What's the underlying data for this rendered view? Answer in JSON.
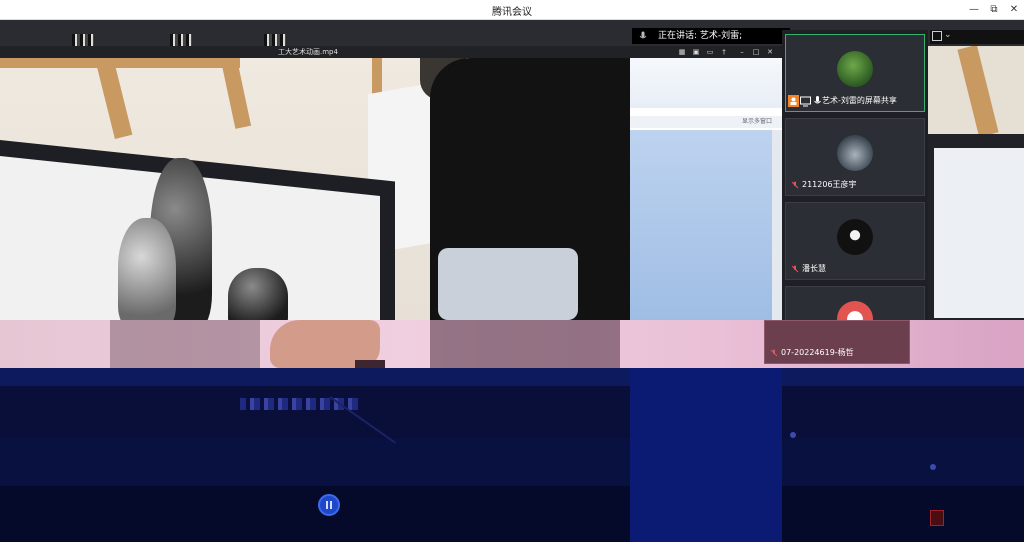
{
  "window": {
    "title": "腾讯会议",
    "minimize_icon": "minimize-icon",
    "maximize_icon": "restore-icon",
    "close_icon": "close-icon"
  },
  "speaking_indicator": {
    "label": "正在讲话: 艺术-刘雷;"
  },
  "player": {
    "file_name": "工大艺术动画.mp4"
  },
  "shared_doc": {
    "toolbar_hint": "显示多窗口"
  },
  "participants": [
    {
      "name": "艺术-刘雷的屏幕共享",
      "state": "sharing"
    },
    {
      "name": "211206王彦宇",
      "state": "muted"
    },
    {
      "name": "潘长慧",
      "state": "muted"
    },
    {
      "name": "07-20224619-杨哲",
      "state": "muted"
    }
  ],
  "colors": {
    "active_border": "#36b36a",
    "share_orange": "#f0852a",
    "card_bg": "#2b2e34",
    "glitch_navy": "#0a0f3a",
    "glitch_pink": "#e6c6d3"
  }
}
